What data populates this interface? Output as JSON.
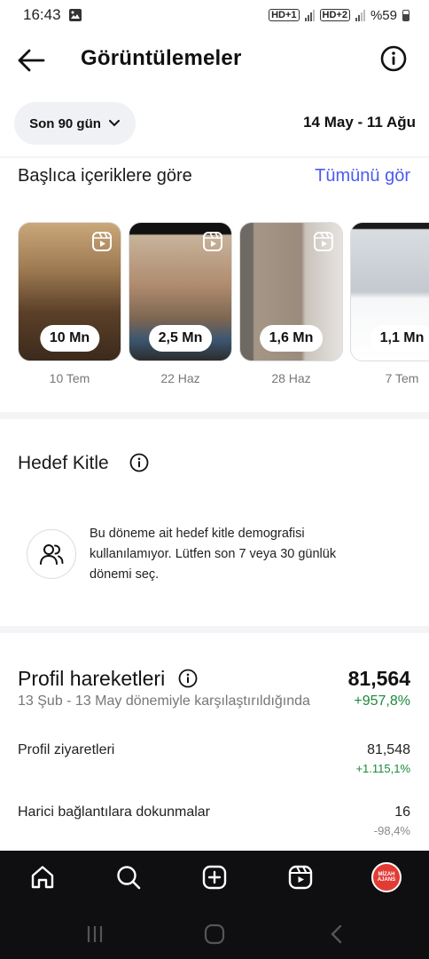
{
  "status_bar": {
    "time": "16:43",
    "network_1": "HD+1",
    "network_2": "HD+2",
    "battery": "%59"
  },
  "header": {
    "title": "Görüntülemeler"
  },
  "filter": {
    "period_label": "Son 90 gün",
    "date_range": "14 May - 11 Ağu"
  },
  "top_content": {
    "title": "Başlıca içeriklere göre",
    "see_all": "Tümünü gör",
    "items": [
      {
        "views": "10 Mn",
        "date": "10 Tem",
        "bg": "#8a6a46"
      },
      {
        "views": "2,5 Mn",
        "date": "22 Haz",
        "bg": "#b69d83"
      },
      {
        "views": "1,6 Mn",
        "date": "28 Haz",
        "bg": "#8d8277"
      },
      {
        "views": "1,1 Mn",
        "date": "7 Tem",
        "bg": "#e9ecef"
      }
    ]
  },
  "audience": {
    "title": "Hedef Kitle",
    "message": "Bu döneme ait hedef kitle demografisi kullanılamıyor. Lütfen son 7 veya 30 günlük dönemi seç."
  },
  "profile_actions": {
    "title": "Profil hareketleri",
    "total": "81,564",
    "comparison": "13 Şub - 13 May dönemiyle karşılaştırıldığında",
    "change": "+957,8%",
    "rows": [
      {
        "label": "Profil ziyaretleri",
        "value": "81,548",
        "change": "+1.115,1%",
        "change_color": "#1a8a3b"
      },
      {
        "label": "Harici bağlantılara dokunmalar",
        "value": "16",
        "change": "-98,4%",
        "change_color": "#888888"
      }
    ]
  },
  "bottom_nav": {
    "avatar_text": "MİZAH AJANS"
  },
  "colors": {
    "accent": "#4a5df0",
    "positive": "#1a8a3b",
    "nav_bg": "#0f0f11"
  }
}
